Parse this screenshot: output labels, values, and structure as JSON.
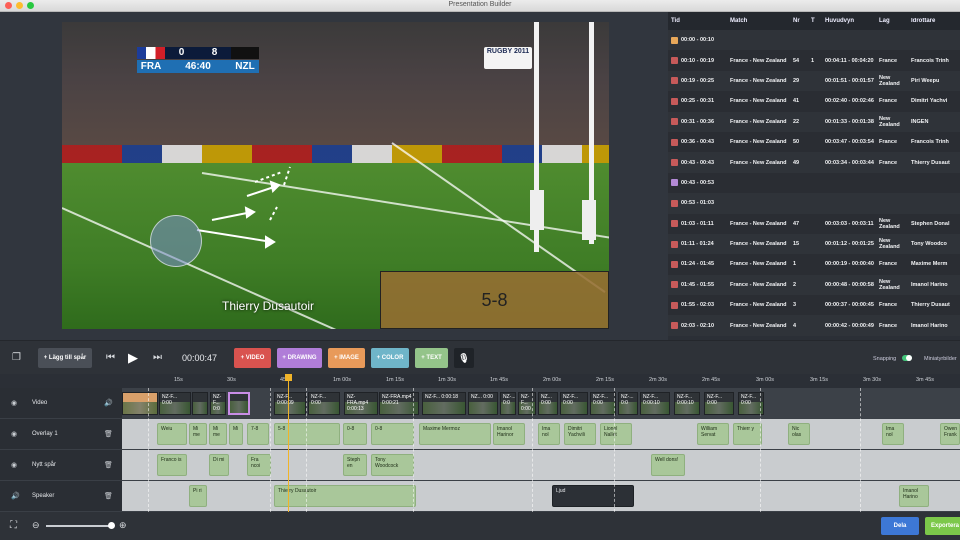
{
  "window": {
    "title": "Presentation Builder"
  },
  "video": {
    "scoreboard": {
      "home": "FRA",
      "away": "NZL",
      "home_score": "0",
      "away_score": "8",
      "clock": "46:40"
    },
    "tournament_badge": "RUGBY 2011",
    "caption": "Thierry Dusautoir",
    "score_overlay": "5-8"
  },
  "table": {
    "headers": {
      "tid": "Tid",
      "match": "Match",
      "nr": "Nr",
      "t": "T",
      "huvudvyn": "Huvudvyn",
      "lag": "Lag",
      "idrottare": "Idrottare"
    },
    "rows": [
      {
        "tid": "00:00 - 00:10",
        "color": "#e9a85a",
        "match": "",
        "nr": "",
        "t": "",
        "huvudvyn": "",
        "lag": "",
        "idrottare": ""
      },
      {
        "tid": "00:10 - 00:19",
        "color": "#c75a5a",
        "match": "France - New Zealand",
        "nr": "54",
        "t": "1",
        "huvudvyn": "00:04:11 - 00:04:20",
        "lag": "France",
        "idrottare": "Francois Trinh"
      },
      {
        "tid": "00:19 - 00:25",
        "color": "#c75a5a",
        "match": "France - New Zealand",
        "nr": "29",
        "t": "",
        "huvudvyn": "00:01:51 - 00:01:57",
        "lag": "New Zealand",
        "idrottare": "Piri Weepu"
      },
      {
        "tid": "00:25 - 00:31",
        "color": "#c75a5a",
        "match": "France - New Zealand",
        "nr": "41",
        "t": "",
        "huvudvyn": "00:02:40 - 00:02:46",
        "lag": "France",
        "idrottare": "Dimitri Yachvi"
      },
      {
        "tid": "00:31 - 00:36",
        "color": "#c75a5a",
        "match": "France - New Zealand",
        "nr": "22",
        "t": "",
        "huvudvyn": "00:01:33 - 00:01:38",
        "lag": "New Zealand",
        "idrottare": "INGEN"
      },
      {
        "tid": "00:36 - 00:43",
        "color": "#c75a5a",
        "match": "France - New Zealand",
        "nr": "50",
        "t": "",
        "huvudvyn": "00:03:47 - 00:03:54",
        "lag": "France",
        "idrottare": "Francois Trinh"
      },
      {
        "tid": "00:43 - 00:43",
        "color": "#c75a5a",
        "match": "France - New Zealand",
        "nr": "49",
        "t": "",
        "huvudvyn": "00:03:34 - 00:03:44",
        "lag": "France",
        "idrottare": "Thierry Dusaut"
      },
      {
        "tid": "00:43 - 00:53",
        "color": "#b48ad6",
        "match": "",
        "nr": "",
        "t": "",
        "huvudvyn": "",
        "lag": "",
        "idrottare": ""
      },
      {
        "tid": "00:53 - 01:03",
        "color": "#c75a5a",
        "match": "",
        "nr": "",
        "t": "",
        "huvudvyn": "",
        "lag": "",
        "idrottare": ""
      },
      {
        "tid": "01:03 - 01:11",
        "color": "#c75a5a",
        "match": "France - New Zealand",
        "nr": "47",
        "t": "",
        "huvudvyn": "00:03:03 - 00:03:11",
        "lag": "New Zealand",
        "idrottare": "Stephen Donal"
      },
      {
        "tid": "01:11 - 01:24",
        "color": "#c75a5a",
        "match": "France - New Zealand",
        "nr": "15",
        "t": "",
        "huvudvyn": "00:01:12 - 00:01:25",
        "lag": "New Zealand",
        "idrottare": "Tony Woodco"
      },
      {
        "tid": "01:24 - 01:45",
        "color": "#c75a5a",
        "match": "France - New Zealand",
        "nr": "1",
        "t": "",
        "huvudvyn": "00:00:19 - 00:00:40",
        "lag": "France",
        "idrottare": "Maxime Merm"
      },
      {
        "tid": "01:45 - 01:55",
        "color": "#c75a5a",
        "match": "France - New Zealand",
        "nr": "2",
        "t": "",
        "huvudvyn": "00:00:48 - 00:00:58",
        "lag": "New Zealand",
        "idrottare": "Imanol Harino"
      },
      {
        "tid": "01:55 - 02:03",
        "color": "#c75a5a",
        "match": "France - New Zealand",
        "nr": "3",
        "t": "",
        "huvudvyn": "00:00:37 - 00:00:45",
        "lag": "France",
        "idrottare": "Thierry Dusaut"
      },
      {
        "tid": "02:03 - 02:10",
        "color": "#c75a5a",
        "match": "France - New Zealand",
        "nr": "4",
        "t": "",
        "huvudvyn": "00:00:42 - 00:00:49",
        "lag": "France",
        "idrottare": "Imanol Harino"
      }
    ]
  },
  "toolbar": {
    "add_track": "+ Lägg till spår",
    "timecode": "00:00:47",
    "video": "+ VIDEO",
    "drawing": "+ DRAWING",
    "image": "+ IMAGE",
    "color": "+ COLOR",
    "text": "+ TEXT",
    "snapping": "Snapping",
    "snapping_on": true,
    "thumbnails": "Miniatyrbilder",
    "colors": {
      "video": "#d9534f",
      "drawing": "#b07dd8",
      "image": "#e89a5a",
      "color": "#6fb5c9",
      "text": "#94c48a"
    }
  },
  "ruler": [
    "15s",
    "30s",
    "45",
    "1m 00s",
    "1m 15s",
    "1m 30s",
    "1m 45s",
    "2m 00s",
    "2m 15s",
    "2m 30s",
    "2m 45s",
    "3m 00s",
    "3m 15s",
    "3m 30s",
    "3m 45s"
  ],
  "tracks": {
    "video": {
      "name": "Video",
      "clip_labels": [
        "",
        "NZ-F... 0:00",
        "",
        "NZ-F... 0:0",
        "",
        "NZ-F... 0:00:09",
        "NZ-F... 0:00",
        "NZ-FRA.mp4 0:00:13",
        "NZ-FRA.mp4 0:00:21",
        "NZ-F... 0:00:18",
        "NZ... 0:00",
        "NZ-... 0:0",
        "NZ-F... 0:00",
        "NZ... 0:00",
        "NZ-F... 0:00",
        "NZ-F... 0:00",
        "NZ-... 0:0",
        "NZ-F... 0:00:10",
        "NZ-F... 0:00:10",
        "NZ-F... 0:00",
        "NZ-F... 0:00"
      ]
    },
    "overlay": {
      "name": "Overlay 1",
      "clips": [
        "Weiu",
        "Mi me",
        "Mi me",
        "Mi",
        "7-8",
        "5-8",
        "0-8",
        "0-8",
        "Maxime Mermoz",
        "Imanol Harinor",
        "Ima nol",
        "Dimitri Yachvili",
        "Lionel Nallet",
        "William Servat",
        "Thierr y",
        "Nic olas",
        "Ima nol",
        "Owen Frank"
      ]
    },
    "nytt": {
      "name": "Nytt spår",
      "clips": [
        "Franco is",
        "Di mi",
        "Fra ncoi",
        "Steph en",
        "Tony Woodcock",
        "Well dons!"
      ]
    },
    "speaker": {
      "name": "Speaker",
      "clips": [
        "Pi ri",
        "Thierry Dusautoir",
        "Ljud",
        "Imanol Harino"
      ]
    }
  },
  "bottom": {
    "share": "Dela",
    "export": "Exportera",
    "share_color": "#3d78d6",
    "export_color": "#7cc84a"
  }
}
